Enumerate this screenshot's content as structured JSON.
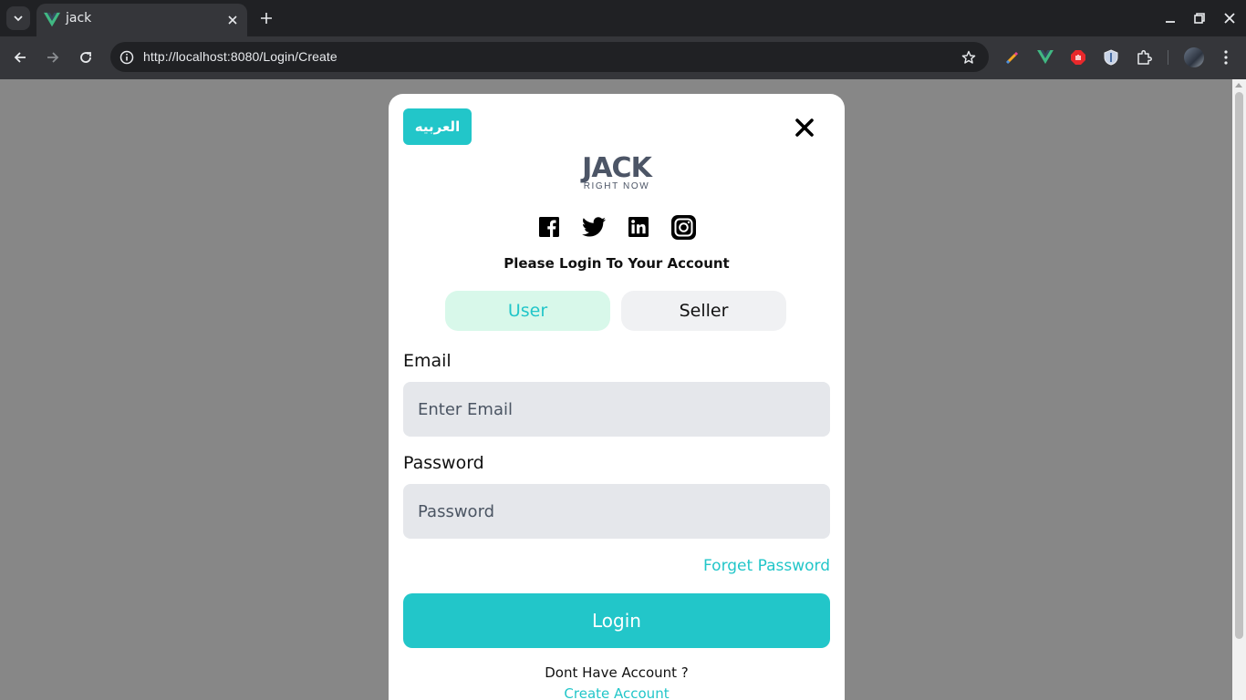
{
  "browser": {
    "tab_title": "jack",
    "url": "http://localhost:8080/Login/Create",
    "extensions": [
      "color-picker-icon",
      "vue-devtools-icon",
      "adblock-icon",
      "shield-icon",
      "puzzle-icon"
    ]
  },
  "modal": {
    "language_button": "العربيه",
    "logo": {
      "main": "JACK",
      "sub": "RIGHT NOW"
    },
    "social": [
      "facebook-icon",
      "twitter-icon",
      "linkedin-icon",
      "instagram-icon"
    ],
    "heading": "Please Login To Your Account",
    "role_tabs": {
      "user": "User",
      "seller": "Seller",
      "active": "User"
    },
    "email": {
      "label": "Email",
      "placeholder": "Enter Email",
      "value": ""
    },
    "password": {
      "label": "Password",
      "placeholder": "Password",
      "value": ""
    },
    "forget_password": "Forget Password",
    "login_button": "Login",
    "no_account": "Dont Have Account ?",
    "create_account": "Create Account"
  },
  "colors": {
    "accent": "#22c6c9",
    "user_tab_bg": "#d8f8ea",
    "backdrop": "#878787",
    "logo": "#4c5566"
  }
}
